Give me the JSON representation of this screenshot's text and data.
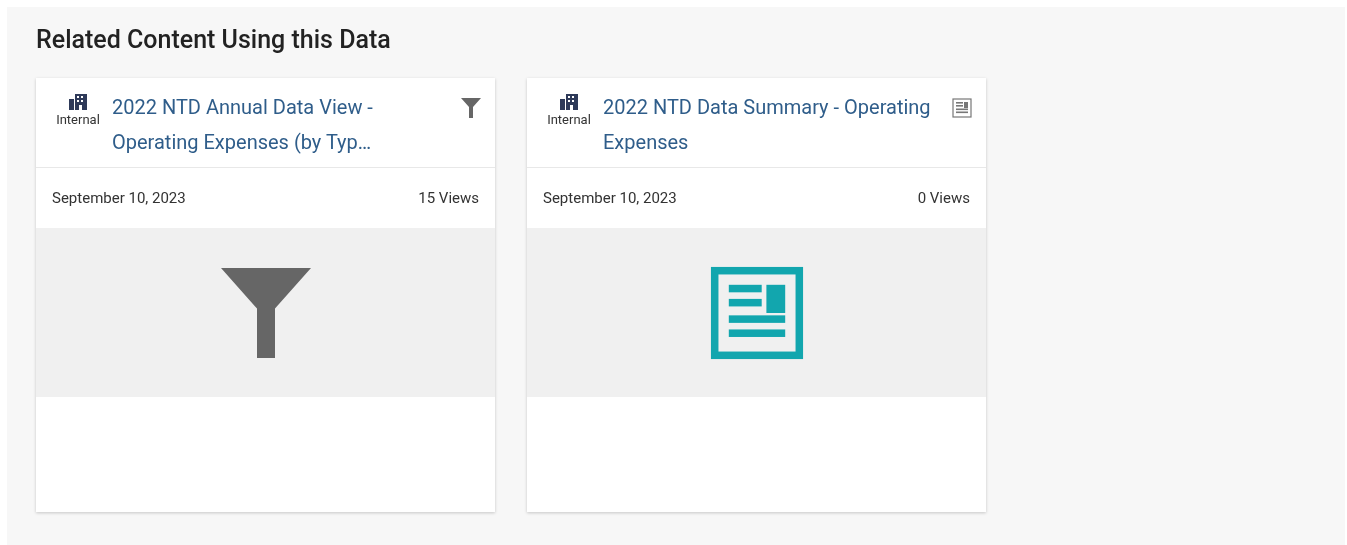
{
  "section": {
    "title": "Related Content Using this Data"
  },
  "cards": [
    {
      "kind": "filter",
      "audience": "Internal",
      "title": "2022 NTD Annual Data View - Operating Expenses (by Typ…",
      "date": "September 10, 2023",
      "views": "15 Views"
    },
    {
      "kind": "story",
      "audience": "Internal",
      "title": "2022 NTD Data Summary - Operating Expenses",
      "date": "September 10, 2023",
      "views": "0 Views"
    }
  ]
}
